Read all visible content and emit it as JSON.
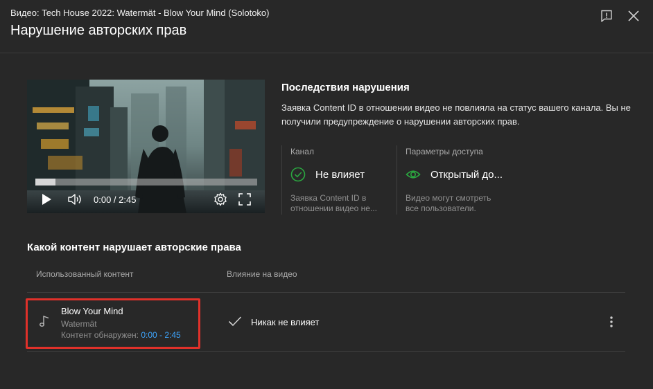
{
  "header": {
    "subtitle": "Видео: Tech House 2022: Watermät - Blow Your Mind (Solotoko)",
    "title": "Нарушение авторских прав"
  },
  "player": {
    "timecode": "0:00 / 2:45",
    "progress_fraction": 0.09
  },
  "consequences": {
    "title": "Последствия нарушения",
    "description": "Заявка Content ID в отношении видео не повлияла на статус вашего канала. Вы не получили предупреждение о нарушении авторских прав.",
    "channel": {
      "label": "Канал",
      "status": "Не влияет",
      "description": "Заявка Content ID в отношении видео не...",
      "icon": "check-circle-icon",
      "color": "#2ba640"
    },
    "visibility": {
      "label": "Параметры доступа",
      "status": "Открытый до...",
      "description": "Видео могут смотреть все пользователи.",
      "icon": "eye-icon",
      "color": "#2ba640"
    }
  },
  "content": {
    "section_title": "Какой контент нарушает авторские права",
    "columns": {
      "used": "Использованный контент",
      "impact": "Влияние на видео"
    },
    "rows": [
      {
        "title": "Blow Your Mind",
        "artist": "Watermät",
        "detected_label": "Контент обнаружен: ",
        "range": "0:00 - 2:45",
        "impact": "Никак не влияет"
      }
    ]
  },
  "colors": {
    "background": "#282828",
    "link": "#3ea6ff",
    "highlight": "#e0312a",
    "success": "#2ba640"
  }
}
